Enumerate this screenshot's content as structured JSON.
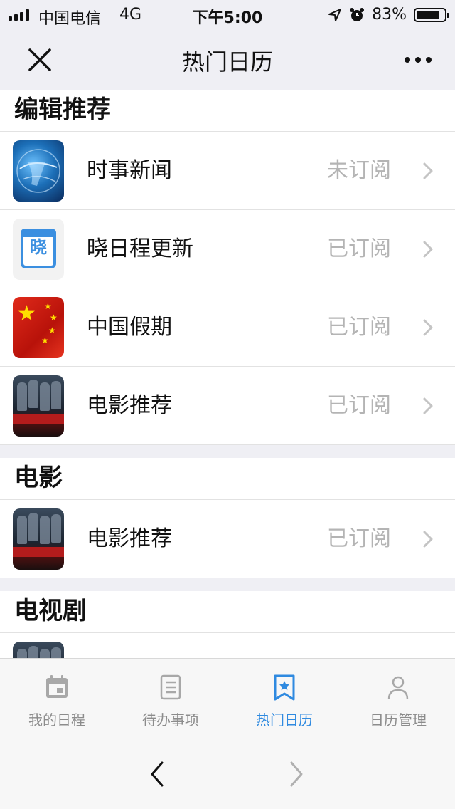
{
  "status_bar": {
    "carrier": "中国电信",
    "network": "4G",
    "time": "下午5:00",
    "battery": "83%",
    "battery_level": 0.83
  },
  "nav": {
    "title": "热门日历"
  },
  "sections": [
    {
      "title": "编辑推荐",
      "items": [
        {
          "title": "时事新闻",
          "status": "未订阅",
          "icon": "globe-news-icon"
        },
        {
          "title": "晓日程更新",
          "status": "已订阅",
          "icon": "calendar-xiao-icon",
          "icon_glyph": "晓"
        },
        {
          "title": "中国假期",
          "status": "已订阅",
          "icon": "china-flag-icon"
        },
        {
          "title": "电影推荐",
          "status": "已订阅",
          "icon": "movie-poster-icon"
        }
      ]
    },
    {
      "title": "电影",
      "items": [
        {
          "title": "电影推荐",
          "status": "已订阅",
          "icon": "movie-poster-icon"
        }
      ]
    },
    {
      "title": "电视剧",
      "items": []
    }
  ],
  "tabs": [
    {
      "label": "我的日程",
      "icon": "calendar-icon",
      "active": false
    },
    {
      "label": "待办事项",
      "icon": "list-icon",
      "active": false
    },
    {
      "label": "热门日历",
      "icon": "bookmark-star-icon",
      "active": true
    },
    {
      "label": "日历管理",
      "icon": "person-icon",
      "active": false
    }
  ],
  "colors": {
    "accent": "#2f8ae0",
    "muted": "#8c8c8c",
    "status_text": "#b4b4b4",
    "background": "#efeff4"
  }
}
